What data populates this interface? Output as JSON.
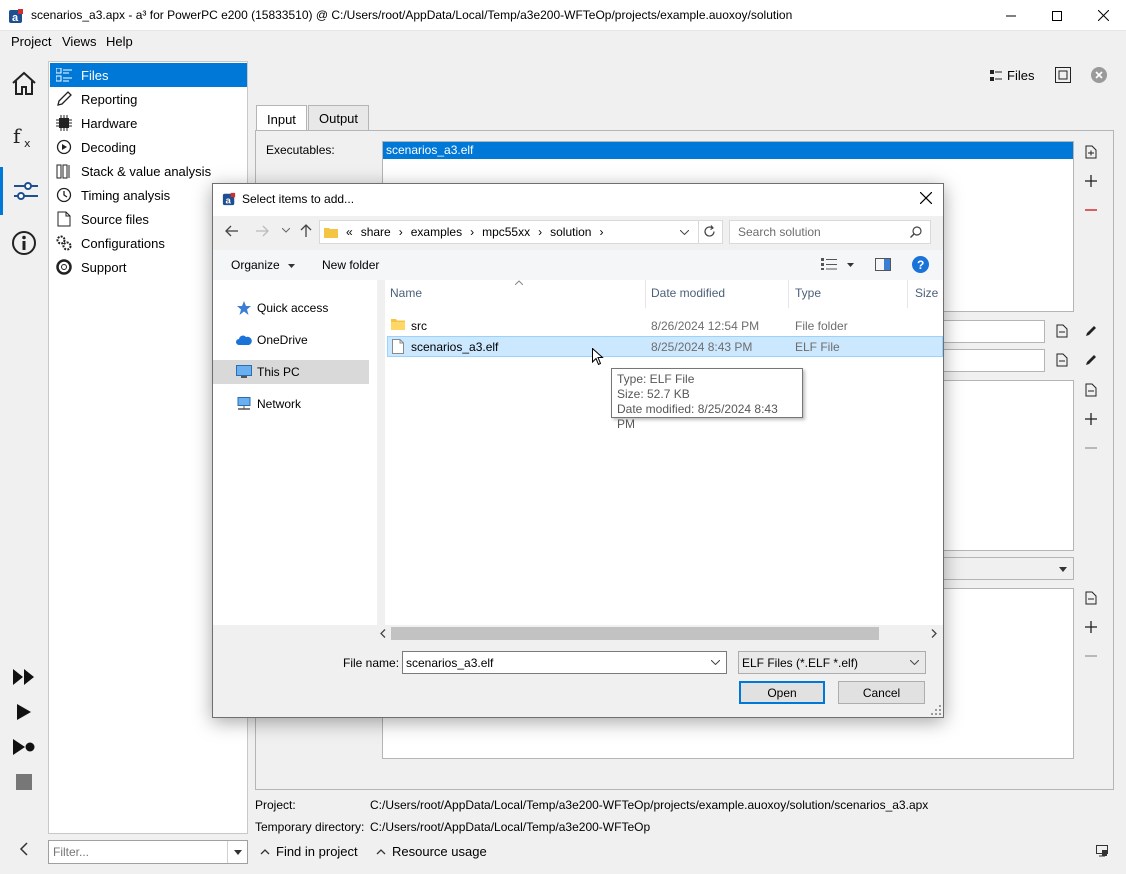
{
  "window": {
    "title": "scenarios_a3.apx - a³ for PowerPC e200 (15833510) @ C:/Users/root/AppData/Local/Temp/a3e200-WFTeOp/projects/example.auoxoy/solution"
  },
  "menu": [
    "Project",
    "Views",
    "Help"
  ],
  "nav": {
    "items": [
      {
        "label": "Files",
        "icon": "files-icon"
      },
      {
        "label": "Reporting",
        "icon": "pencil-icon"
      },
      {
        "label": "Hardware",
        "icon": "chip-icon"
      },
      {
        "label": "Decoding",
        "icon": "decoding-icon"
      },
      {
        "label": "Stack & value analysis",
        "icon": "stack-icon"
      },
      {
        "label": "Timing analysis",
        "icon": "clock-icon"
      },
      {
        "label": "Source files",
        "icon": "source-file-icon"
      },
      {
        "label": "Configurations",
        "icon": "gears-icon"
      },
      {
        "label": "Support",
        "icon": "lifebuoy-icon"
      }
    ],
    "filter_placeholder": "Filter..."
  },
  "header": {
    "files_label": "Files"
  },
  "tabs": [
    "Input",
    "Output"
  ],
  "input": {
    "executables_label": "Executables:",
    "executables": [
      "scenarios_a3.elf"
    ]
  },
  "dialog": {
    "title": "Select items to add...",
    "breadcrumb": [
      "«",
      "share",
      "examples",
      "mpc55xx",
      "solution"
    ],
    "search_placeholder": "Search solution",
    "organize": "Organize",
    "new_folder": "New folder",
    "nav_pane": [
      "Quick access",
      "OneDrive",
      "This PC",
      "Network"
    ],
    "columns": [
      "Name",
      "Date modified",
      "Type",
      "Size"
    ],
    "rows": [
      {
        "name": "src",
        "date": "8/26/2024 12:54 PM",
        "type": "File folder",
        "icon": "folder-icon"
      },
      {
        "name": "scenarios_a3.elf",
        "date": "8/25/2024 8:43 PM",
        "type": "ELF File",
        "icon": "file-icon"
      }
    ],
    "tooltip": {
      "type": "Type: ELF File",
      "size": "Size: 52.7 KB",
      "date": "Date modified: 8/25/2024 8:43 PM"
    },
    "file_name_label": "File name:",
    "file_name": "scenarios_a3.elf",
    "filter": "ELF Files (*.ELF *.elf)",
    "open": "Open",
    "cancel": "Cancel"
  },
  "status": {
    "project_label": "Project:",
    "project_path": "C:/Users/root/AppData/Local/Temp/a3e200-WFTeOp/projects/example.auoxoy/solution/scenarios_a3.apx",
    "tempdir_label": "Temporary directory:",
    "tempdir_path": "C:/Users/root/AppData/Local/Temp/a3e200-WFTeOp"
  },
  "footer": {
    "find": "Find in project",
    "resource": "Resource usage"
  },
  "colors": {
    "accent": "#0078d7",
    "selection_light": "#cce8ff",
    "remove_red": "#d32f2f"
  }
}
